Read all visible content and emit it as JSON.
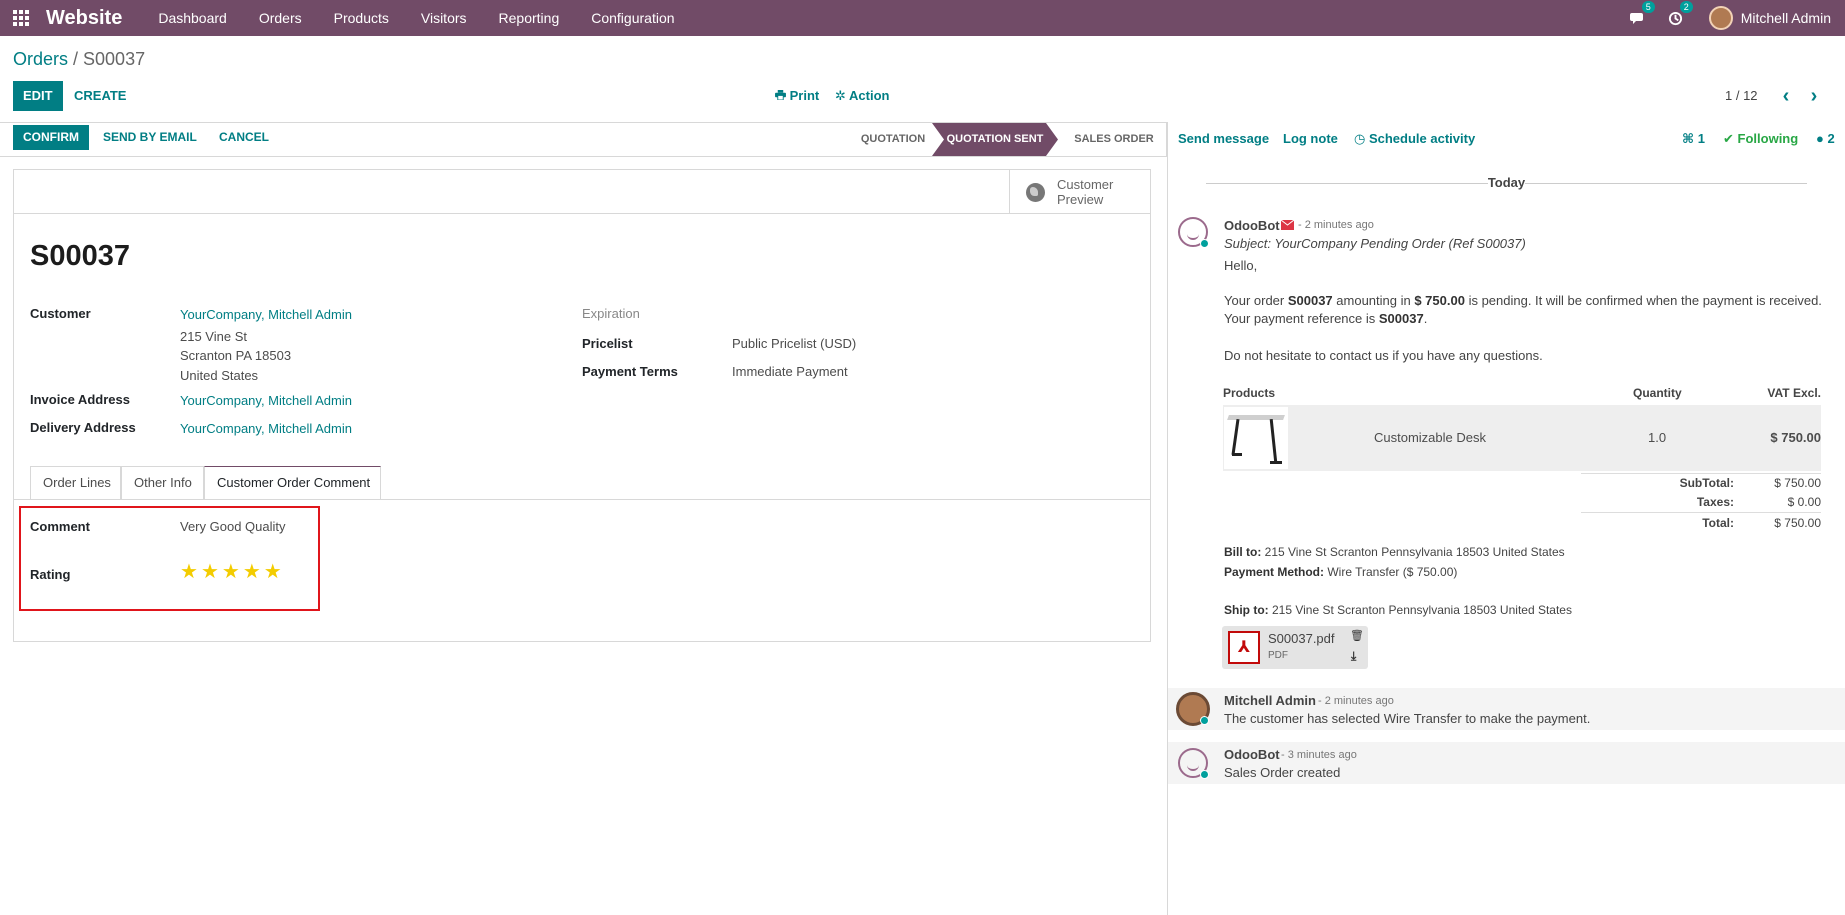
{
  "topbar": {
    "app_name": "Website",
    "menu": [
      "Dashboard",
      "Orders",
      "Products",
      "Visitors",
      "Reporting",
      "Configuration"
    ],
    "messages_count": "5",
    "activities_count": "2",
    "user_name": "Mitchell Admin"
  },
  "breadcrumb": {
    "parent": "Orders",
    "separator": " / ",
    "current": "S00037"
  },
  "control": {
    "edit": "Edit",
    "create": "Create",
    "print": "Print",
    "action": "Action",
    "pager": "1 / 12"
  },
  "statusbar": {
    "buttons": [
      "Confirm",
      "Send by Email",
      "Cancel"
    ],
    "stages": [
      "Quotation",
      "Quotation Sent",
      "Sales Order"
    ],
    "active_stage": "Quotation Sent"
  },
  "form": {
    "preview_button": "Customer Preview",
    "name": "S00037",
    "customer_label": "Customer",
    "customer_value": "YourCompany, Mitchell Admin",
    "address": [
      "215 Vine St",
      "Scranton PA 18503",
      "United States"
    ],
    "invoice_label": "Invoice Address",
    "invoice_value": "YourCompany, Mitchell Admin",
    "delivery_label": "Delivery Address",
    "delivery_value": "YourCompany, Mitchell Admin",
    "expiration_label": "Expiration",
    "pricelist_label": "Pricelist",
    "pricelist_value": "Public Pricelist (USD)",
    "payment_terms_label": "Payment Terms",
    "payment_terms_value": "Immediate Payment",
    "tabs": [
      "Order Lines",
      "Other Info",
      "Customer Order Comment"
    ],
    "active_tab": "Customer Order Comment",
    "comment_label": "Comment",
    "comment_value": "Very Good Quality",
    "rating_label": "Rating",
    "rating_value": 5,
    "rating_max": 5
  },
  "chatter": {
    "send_message": "Send message",
    "log_note": "Log note",
    "schedule_activity": "Schedule activity",
    "attachments_count": "1",
    "following": "Following",
    "followers_count": "2",
    "today": "Today",
    "messages": [
      {
        "author": "OdooBot",
        "time": "- 2 minutes ago",
        "subject": "Subject: YourCompany Pending Order (Ref S00037)",
        "greeting": "Hello,",
        "body_1": "Your order ",
        "order_ref": "S00037",
        "body_2": " amounting in ",
        "amount": "$ 750.00",
        "body_3": " is pending. It will be confirmed when the payment is received. Your payment reference is ",
        "payment_ref": "S00037",
        "body_4": ".",
        "closing": "Do not hesitate to contact us if you have any questions.",
        "table_headers": [
          "Products",
          "Quantity",
          "VAT Excl."
        ],
        "product_name": "Customizable Desk",
        "product_qty": "1.0",
        "product_price": "$ 750.00",
        "subtotal_label": "SubTotal:",
        "subtotal": "$ 750.00",
        "taxes_label": "Taxes:",
        "taxes": "$ 0.00",
        "total_label": "Total:",
        "total": "$ 750.00",
        "bill_label": "Bill to:",
        "bill_value": " 215 Vine St Scranton Pennsylvania 18503 United States",
        "payment_label": "Payment Method:",
        "payment_value": " Wire Transfer ($ 750.00)",
        "ship_label": "Ship to:",
        "ship_value": " 215 Vine St Scranton Pennsylvania 18503 United States",
        "attachment_name": "S00037.pdf",
        "attachment_type": "PDF"
      },
      {
        "author": "Mitchell Admin",
        "time": "- 2 minutes ago",
        "text": "The customer has selected Wire Transfer to make the payment."
      },
      {
        "author": "OdooBot",
        "time": "- 3 minutes ago",
        "text": "Sales Order created"
      }
    ]
  },
  "colors": {
    "brand": "#714b67",
    "accent": "#017e84",
    "highlight": "#e0151b",
    "star": "#f3cc00"
  }
}
